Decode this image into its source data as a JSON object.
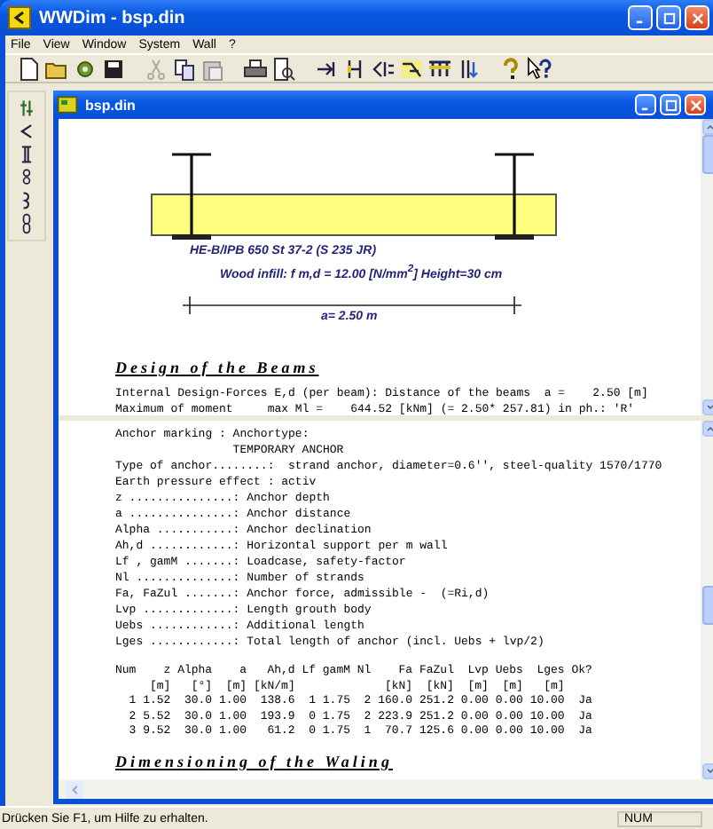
{
  "window": {
    "title": "WWDim - bsp.din"
  },
  "menu": [
    "File",
    "View",
    "Window",
    "System",
    "Wall",
    "?"
  ],
  "document": {
    "title": "bsp.din",
    "diagram": {
      "profile_label": "HE-B/IPB 650  St 37-2 (S 235 JR)",
      "infill_label": "Wood infill: f m,d = 12.00 [N/mm$^{2}$] Height=30 cm",
      "distance_label": "a=  2.50 m"
    },
    "top_heading": "Design of the Beams",
    "top_lines": [
      "Internal Design-Forces E,d (per beam): Distance of the beams  a =    2.50 [m]",
      "Maximum of moment     max Ml =    644.52 [kNm] (= 2.50* 257.81) in ph.: 'R'"
    ],
    "anchor_marking": {
      "label": "Anchor marking : Anchortype:",
      "type_name": "TEMPORARY ANCHOR"
    },
    "legend_lines": [
      "Type of anchor........:  strand anchor, diameter=0.6'', steel-quality 1570/1770",
      "Earth pressure effect : activ",
      "z ...............: Anchor depth",
      "a ...............: Anchor distance",
      "Alpha ...........: Anchor declination",
      "Ah,d ............: Horizontal support per m wall",
      "Lf , gamM .......: Loadcase, safety-factor",
      "Nl ..............: Number of strands",
      "Fa, FaZul .......: Anchor force, admissible -  (=Ri,d)",
      "Lvp .............: Length grouth body",
      "Uebs ............: Additional length",
      "Lges ............: Total length of anchor (incl. Uebs + lvp/2)"
    ],
    "anchor_table": {
      "columns": [
        {
          "label": "Num"
        },
        {
          "label": "z",
          "unit": "[m]"
        },
        {
          "label": "Alpha",
          "unit": "[°]"
        },
        {
          "label": "a",
          "unit": "[m]"
        },
        {
          "label": "Ah,d",
          "unit": "[kN/m]"
        },
        {
          "label": "Lf"
        },
        {
          "label": "gamM"
        },
        {
          "label": "Nl"
        },
        {
          "label": "Fa",
          "unit": "[kN]"
        },
        {
          "label": "FaZul",
          "unit": "[kN]"
        },
        {
          "label": "Lvp",
          "unit": "[m]"
        },
        {
          "label": "Uebs",
          "unit": "[m]"
        },
        {
          "label": "Lges",
          "unit": "[m]"
        },
        {
          "label": "Ok?"
        }
      ],
      "rows": [
        [
          "1",
          "1.52",
          "30.0",
          "1.00",
          "138.6",
          "1",
          "1.75",
          "2",
          "160.0",
          "251.2",
          "0.00",
          "0.00",
          "10.00",
          "Ja"
        ],
        [
          "2",
          "5.52",
          "30.0",
          "1.00",
          "193.9",
          "0",
          "1.75",
          "2",
          "223.9",
          "251.2",
          "0.00",
          "0.00",
          "10.00",
          "Ja"
        ],
        [
          "3",
          "9.52",
          "30.0",
          "1.00",
          "61.2",
          "0",
          "1.75",
          "1",
          "70.7",
          "125.6",
          "0.00",
          "0.00",
          "10.00",
          "Ja"
        ]
      ]
    },
    "bottom_heading": "Dimensioning of the Waling"
  },
  "status_bar": {
    "message": "Drücken Sie F1, um Hilfe zu erhalten.",
    "indicator": "NUM"
  }
}
